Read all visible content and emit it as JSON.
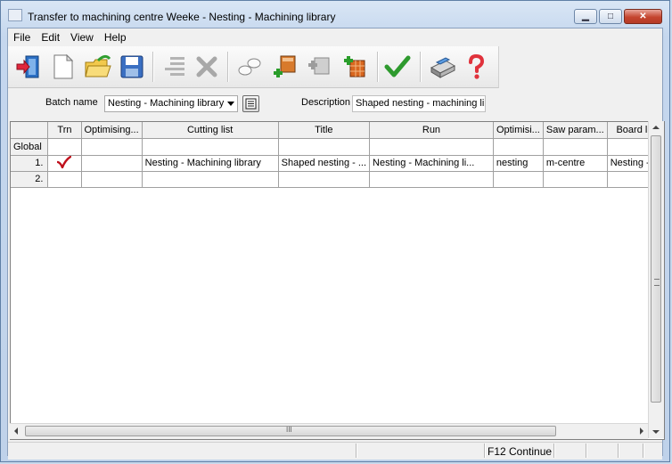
{
  "window": {
    "title": "Transfer to machining centre Weeke - Nesting - Machining library"
  },
  "menu": {
    "items": [
      "File",
      "Edit",
      "View",
      "Help"
    ]
  },
  "toolbar": {
    "buttons": [
      "exit-icon",
      "new-document-icon",
      "open-folder-icon",
      "save-disk-icon",
      "delete-line-icon",
      "cancel-x-icon",
      "link-icon",
      "add-board-icon",
      "copy-board-icon",
      "add-pattern-icon",
      "confirm-check-icon",
      "print-icon",
      "help-question-icon"
    ]
  },
  "filter": {
    "batch_label": "Batch name",
    "batch_value": "Nesting - Machining library",
    "description_label": "Description",
    "description_value": "Shaped nesting - machining lib"
  },
  "grid": {
    "columns": [
      "Trn",
      "Optimising...",
      "Cutting list",
      "Title",
      "Run",
      "Optimisi...",
      "Saw param...",
      "Board lis"
    ],
    "global_label": "Global",
    "rows": [
      {
        "num": "1.",
        "checked": true,
        "optimising": "",
        "cutting_list": "Nesting - Machining library",
        "title": "Shaped nesting - ...",
        "run": "Nesting - Machining li...",
        "optimisi": "nesting",
        "saw_param": "m-centre",
        "board": "Nesting - ..."
      },
      {
        "num": "2.",
        "checked": false,
        "optimising": "",
        "cutting_list": "",
        "title": "",
        "run": "",
        "optimisi": "",
        "saw_param": "",
        "board": ""
      }
    ]
  },
  "scrollbars": {
    "grip": "III"
  },
  "status": {
    "text": "F12 Continue"
  }
}
